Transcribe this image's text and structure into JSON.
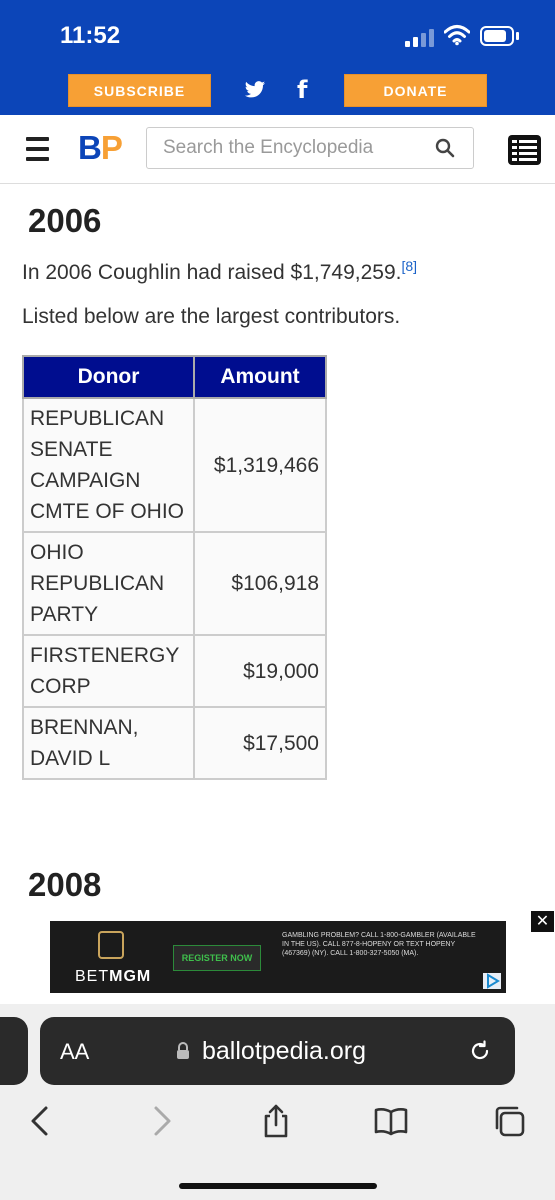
{
  "status_bar": {
    "time": "11:52"
  },
  "header": {
    "subscribe_label": "SUBSCRIBE",
    "donate_label": "DONATE",
    "logo_b": "B",
    "logo_p": "P",
    "search_placeholder": "Search the Encyclopedia",
    "brand_blue": "#0c45b8",
    "brand_orange": "#f7a035"
  },
  "content": {
    "heading_2006": "2006",
    "para_raised": "In 2006 Coughlin had raised $1,749,259.",
    "footnote": "[8]",
    "para_listed": "Listed below are the largest contributors.",
    "table": {
      "headers": [
        "Donor",
        "Amount"
      ],
      "rows": [
        {
          "donor": "REPUBLICAN SENATE CAMPAIGN CMTE OF OHIO",
          "amount": "$1,319,466"
        },
        {
          "donor": "OHIO REPUBLICAN PARTY",
          "amount": "$106,918"
        },
        {
          "donor": "FIRSTENERGY CORP",
          "amount": "$19,000"
        },
        {
          "donor": "BRENNAN, DAVID L",
          "amount": "$17,500"
        }
      ]
    },
    "heading_2008": "2008"
  },
  "ad": {
    "close": "✕",
    "brand_light": "BET",
    "brand_bold": "MGM",
    "register": "REGISTER NOW",
    "disclaimer": "GAMBLING PROBLEM? CALL 1-800-GAMBLER (AVAILABLE IN THE US). CALL 877-8-HOPENY OR TEXT HOPENY (467369) (NY). CALL 1-800-327-5050 (MA)."
  },
  "browser": {
    "aa_label": "AA",
    "url": "ballotpedia.org"
  }
}
